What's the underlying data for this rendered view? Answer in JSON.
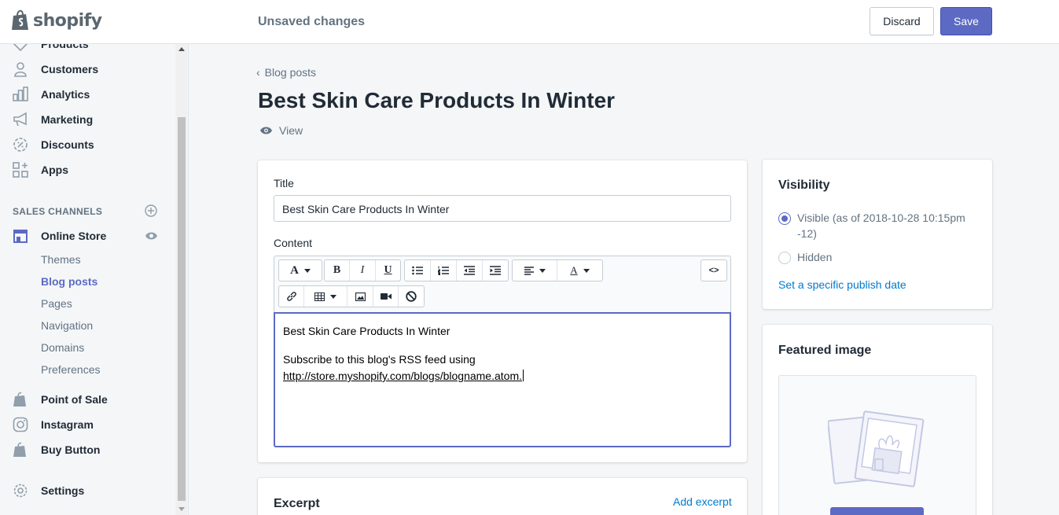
{
  "topbar": {
    "logo_text": "shopify",
    "status": "Unsaved changes",
    "discard_label": "Discard",
    "save_label": "Save"
  },
  "sidebar": {
    "items": [
      {
        "label": "Products",
        "icon": "tag-icon"
      },
      {
        "label": "Customers",
        "icon": "person-icon"
      },
      {
        "label": "Analytics",
        "icon": "bar-chart-icon"
      },
      {
        "label": "Marketing",
        "icon": "megaphone-icon"
      },
      {
        "label": "Discounts",
        "icon": "discount-icon"
      },
      {
        "label": "Apps",
        "icon": "apps-icon"
      }
    ],
    "sales_channels_heading": "SALES CHANNELS",
    "online_store": "Online Store",
    "online_store_sub": [
      "Themes",
      "Blog posts",
      "Pages",
      "Navigation",
      "Domains",
      "Preferences"
    ],
    "active_sub": "Blog posts",
    "channels": [
      {
        "label": "Point of Sale",
        "icon": "shopify-bag-icon"
      },
      {
        "label": "Instagram",
        "icon": "instagram-icon"
      },
      {
        "label": "Buy Button",
        "icon": "shopify-bag-icon"
      }
    ],
    "settings": "Settings"
  },
  "main": {
    "breadcrumb": "Blog posts",
    "title": "Best Skin Care Products In Winter",
    "view_label": "View",
    "form": {
      "title_label": "Title",
      "title_value": "Best Skin Care Products In Winter",
      "content_label": "Content",
      "content_line1": "Best Skin Care Products In Winter",
      "content_line2": "Subscribe to this blog's RSS feed using",
      "content_url": "http://store.myshopify.com/blogs/blogname.atom."
    },
    "excerpt": {
      "heading": "Excerpt",
      "add_label": "Add excerpt"
    }
  },
  "visibility": {
    "heading": "Visibility",
    "visible_label": "Visible (as of 2018-10-28 10:15pm -12)",
    "hidden_label": "Hidden",
    "selected": "Visible",
    "publish_link": "Set a specific publish date"
  },
  "featured_image": {
    "heading": "Featured image"
  },
  "colors": {
    "accent": "#5c6ac4",
    "link": "#007ace",
    "text_subdued": "#637381"
  }
}
